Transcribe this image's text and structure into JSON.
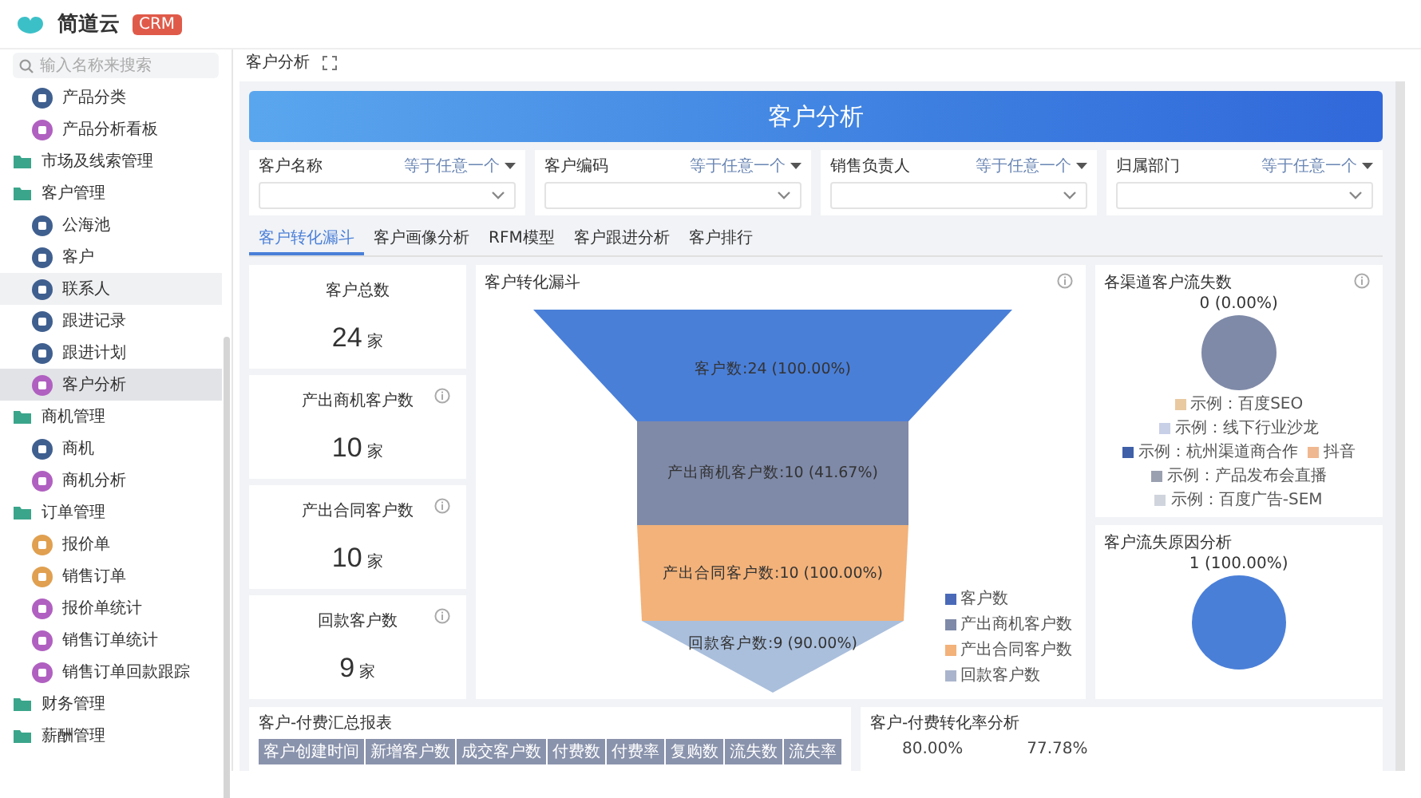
{
  "app": {
    "logo": "简道云",
    "badge": "CRM"
  },
  "sidebar": {
    "search_placeholder": "输入名称来搜索",
    "items": [
      {
        "kind": "item",
        "label": "产品分类",
        "color": "#3f5f8f",
        "selected": false,
        "hovered": false
      },
      {
        "kind": "item",
        "label": "产品分析看板",
        "color": "#b060c0",
        "selected": false,
        "hovered": false
      },
      {
        "kind": "group",
        "label": "市场及线索管理"
      },
      {
        "kind": "group",
        "label": "客户管理",
        "children": [
          {
            "kind": "item",
            "label": "公海池",
            "color": "#3f5f8f",
            "selected": false,
            "hovered": false
          },
          {
            "kind": "item",
            "label": "客户",
            "color": "#3f5f8f",
            "selected": false,
            "hovered": false
          },
          {
            "kind": "item",
            "label": "联系人",
            "color": "#3f5f8f",
            "selected": false,
            "hovered": true
          },
          {
            "kind": "item",
            "label": "跟进记录",
            "color": "#3f5f8f",
            "selected": false,
            "hovered": false
          },
          {
            "kind": "item",
            "label": "跟进计划",
            "color": "#3f5f8f",
            "selected": false,
            "hovered": false
          },
          {
            "kind": "item",
            "label": "客户分析",
            "color": "#b060c0",
            "selected": true,
            "hovered": false
          }
        ]
      },
      {
        "kind": "group",
        "label": "商机管理",
        "children": [
          {
            "kind": "item",
            "label": "商机",
            "color": "#3f5f8f",
            "selected": false,
            "hovered": false
          },
          {
            "kind": "item",
            "label": "商机分析",
            "color": "#b060c0",
            "selected": false,
            "hovered": false
          }
        ]
      },
      {
        "kind": "group",
        "label": "订单管理",
        "children": [
          {
            "kind": "item",
            "label": "报价单",
            "color": "#e0a050",
            "selected": false,
            "hovered": false
          },
          {
            "kind": "item",
            "label": "销售订单",
            "color": "#e0a050",
            "selected": false,
            "hovered": false
          },
          {
            "kind": "item",
            "label": "报价单统计",
            "color": "#b060c0",
            "selected": false,
            "hovered": false
          },
          {
            "kind": "item",
            "label": "销售订单统计",
            "color": "#b060c0",
            "selected": false,
            "hovered": false
          },
          {
            "kind": "item",
            "label": "销售订单回款跟踪",
            "color": "#b060c0",
            "selected": false,
            "hovered": false
          }
        ]
      },
      {
        "kind": "group",
        "label": "财务管理"
      },
      {
        "kind": "group",
        "label": "薪酬管理"
      }
    ]
  },
  "breadcrumb": "客户分析",
  "banner": {
    "title": "客户分析"
  },
  "filters": [
    {
      "label": "客户名称",
      "operator": "等于任意一个"
    },
    {
      "label": "客户编码",
      "operator": "等于任意一个"
    },
    {
      "label": "销售负责人",
      "operator": "等于任意一个"
    },
    {
      "label": "归属部门",
      "operator": "等于任意一个"
    }
  ],
  "tabs": [
    {
      "label": "客户转化漏斗",
      "selected": true
    },
    {
      "label": "客户画像分析",
      "selected": false
    },
    {
      "label": "RFM模型",
      "selected": false
    },
    {
      "label": "客户跟进分析",
      "selected": false
    },
    {
      "label": "客户排行",
      "selected": false
    }
  ],
  "stats": [
    {
      "title": "客户总数",
      "value": "24",
      "unit": "家",
      "info": false
    },
    {
      "title": "产出商机客户数",
      "value": "10",
      "unit": "家",
      "info": true
    },
    {
      "title": "产出合同客户数",
      "value": "10",
      "unit": "家",
      "info": true
    },
    {
      "title": "回款客户数",
      "value": "9",
      "unit": "家",
      "info": true
    }
  ],
  "funnel": {
    "title": "客户转化漏斗",
    "stages": [
      {
        "label": "客户数:24 (100.00%)",
        "color": "#4a7fd8"
      },
      {
        "label": "产出商机客户数:10 (41.67%)",
        "color": "#7f8aa8"
      },
      {
        "label": "产出合同客户数:10 (100.00%)",
        "color": "#f2b27a"
      },
      {
        "label": "回款客户数:9 (90.00%)",
        "color": "#aabfdc"
      }
    ],
    "legend": [
      {
        "label": "客户数",
        "color": "#4a6ab8"
      },
      {
        "label": "产出商机客户数",
        "color": "#7f8aa8"
      },
      {
        "label": "产出合同客户数",
        "color": "#f2b27a"
      },
      {
        "label": "回款客户数",
        "color": "#aab4cc"
      }
    ]
  },
  "pies": [
    {
      "title": "各渠道客户流失数",
      "slice_label": "0 (0.00%)",
      "color": "#7f8aa8",
      "info": true,
      "legend": [
        {
          "label": "示例：百度SEO",
          "color": "#e8c9a0"
        },
        {
          "label": "示例：线下行业沙龙",
          "color": "#c8d0e8"
        },
        {
          "label": "示例：杭州渠道商合作",
          "color": "#3f5fa8"
        },
        {
          "label": "抖音",
          "color": "#f0b890"
        },
        {
          "label": "示例：产品发布会直播",
          "color": "#9aa0b0"
        },
        {
          "label": "示例：百度广告-SEM",
          "color": "#d0d4dc"
        }
      ]
    },
    {
      "title": "客户流失原因分析",
      "slice_label": "1 (100.00%)",
      "color": "#4a7fd8",
      "info": false
    }
  ],
  "table": {
    "title": "客户-付费汇总报表",
    "columns": [
      "客户创建时间",
      "新增客户数",
      "成交客户数",
      "付费数",
      "付费率",
      "复购数",
      "流失数",
      "流失率"
    ]
  },
  "rate": {
    "title": "客户-付费转化率分析",
    "values": [
      "80.00%",
      "77.78%"
    ]
  }
}
